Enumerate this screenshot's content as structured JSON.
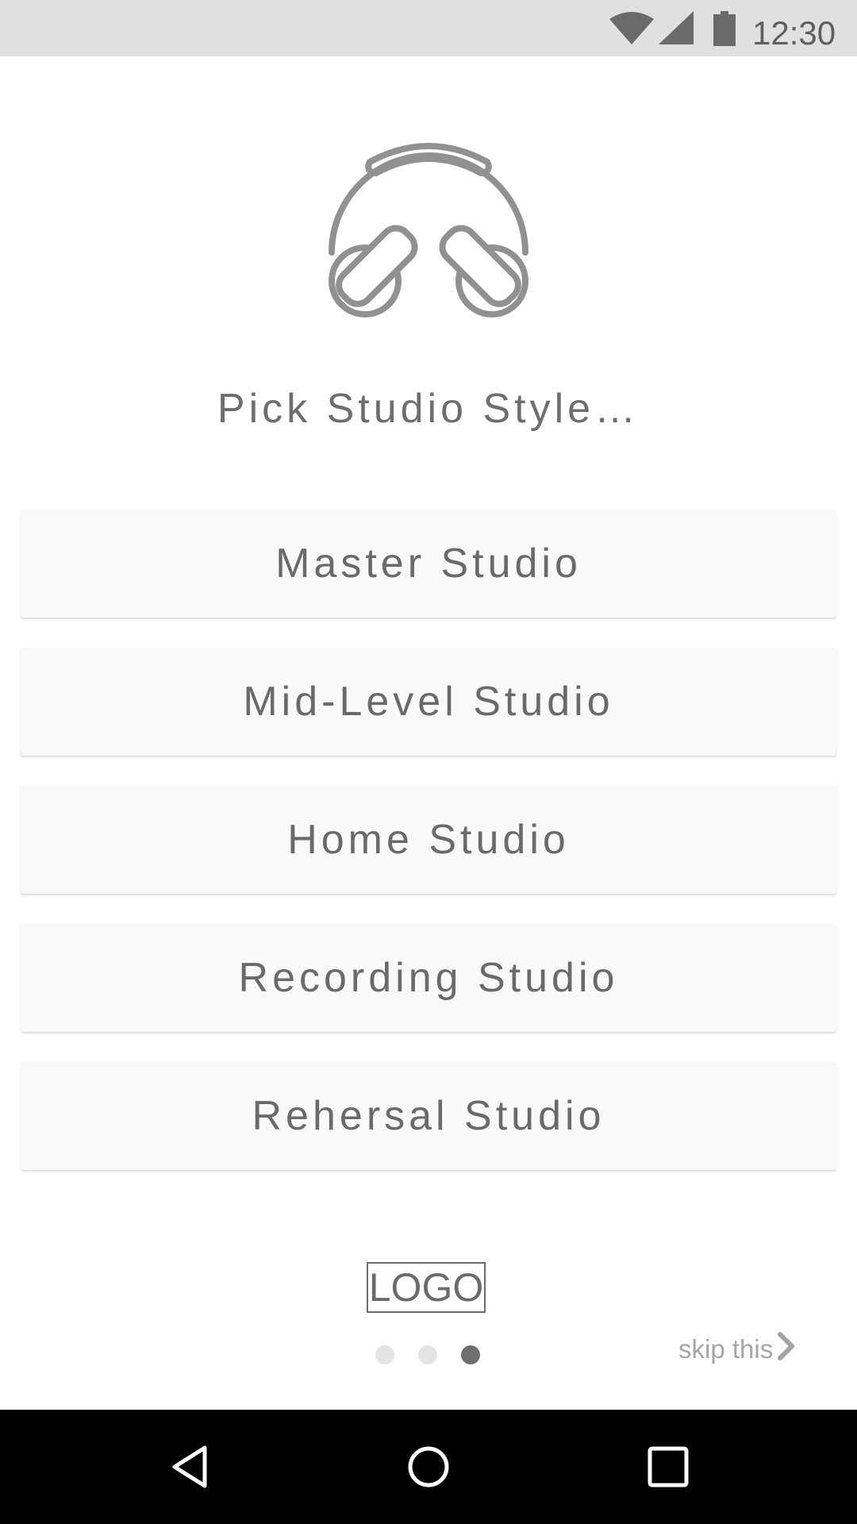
{
  "status_bar": {
    "time": "12:30",
    "icons": [
      "wifi-icon",
      "cell-signal-icon",
      "battery-icon"
    ]
  },
  "hero": {
    "icon": "headphones-icon",
    "prompt": "Pick Studio Style…"
  },
  "options": [
    {
      "label": "Master Studio"
    },
    {
      "label": "Mid-Level Studio"
    },
    {
      "label": "Home Studio"
    },
    {
      "label": "Recording Studio"
    },
    {
      "label": "Rehersal Studio"
    }
  ],
  "logo": {
    "text": "LOGO"
  },
  "pager": {
    "total": 3,
    "active_index": 2
  },
  "skip": {
    "label": "skip this",
    "icon": "chevron-right-icon"
  },
  "nav_bar": {
    "buttons": [
      "back-icon",
      "home-icon",
      "recents-icon"
    ]
  },
  "colors": {
    "status_bar_bg": "#e0e0e0",
    "text": "#6e6e6e",
    "option_bg": "#f9f9f9",
    "nav_bar_bg": "#000000",
    "dot_inactive": "#e4e4e4",
    "dot_active": "#6e6e6e",
    "skip_text": "#a5a5a5"
  }
}
